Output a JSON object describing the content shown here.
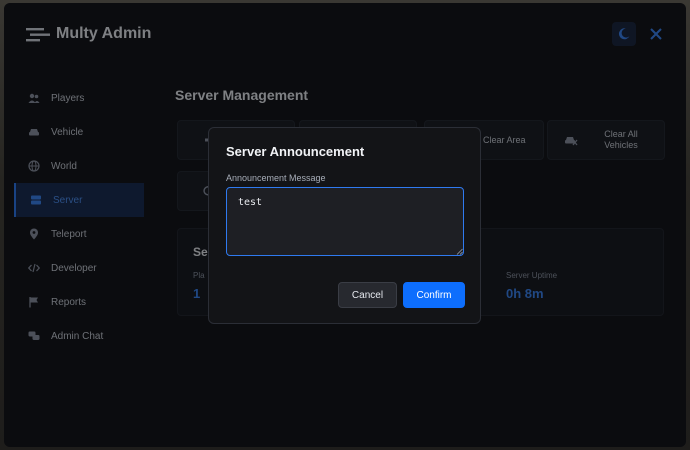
{
  "header": {
    "title": "Multy Admin"
  },
  "sidebar": {
    "items": [
      {
        "label": "Players",
        "icon": "users-icon"
      },
      {
        "label": "Vehicle",
        "icon": "car-icon"
      },
      {
        "label": "World",
        "icon": "globe-icon"
      },
      {
        "label": "Server",
        "icon": "server-icon",
        "active": true
      },
      {
        "label": "Teleport",
        "icon": "map-pin-icon"
      },
      {
        "label": "Developer",
        "icon": "code-icon"
      },
      {
        "label": "Reports",
        "icon": "flag-icon"
      },
      {
        "label": "Admin Chat",
        "icon": "chat-icon"
      }
    ]
  },
  "main": {
    "title": "Server Management",
    "actions": [
      {
        "label": "",
        "icon": "announce-icon"
      },
      {
        "label": "",
        "icon": "generic-icon"
      },
      {
        "label": "Clear Area",
        "icon": "broom-icon"
      },
      {
        "label": "Clear All Vehicles",
        "icon": "car-off-icon"
      },
      {
        "label": "",
        "icon": "refresh-icon"
      }
    ],
    "info_card": {
      "title_fragment": "Se",
      "players_label_fragment": "Pla",
      "players_value": "1",
      "uptime_label": "Server Uptime",
      "uptime_value": "0h 8m"
    }
  },
  "modal": {
    "title": "Server Announcement",
    "field_label": "Announcement Message",
    "message_value": "test",
    "cancel_label": "Cancel",
    "confirm_label": "Confirm"
  },
  "colors": {
    "accent": "#0d6efd",
    "panel_bg": "#14161c",
    "sidebar_active": "#1b2f55"
  }
}
